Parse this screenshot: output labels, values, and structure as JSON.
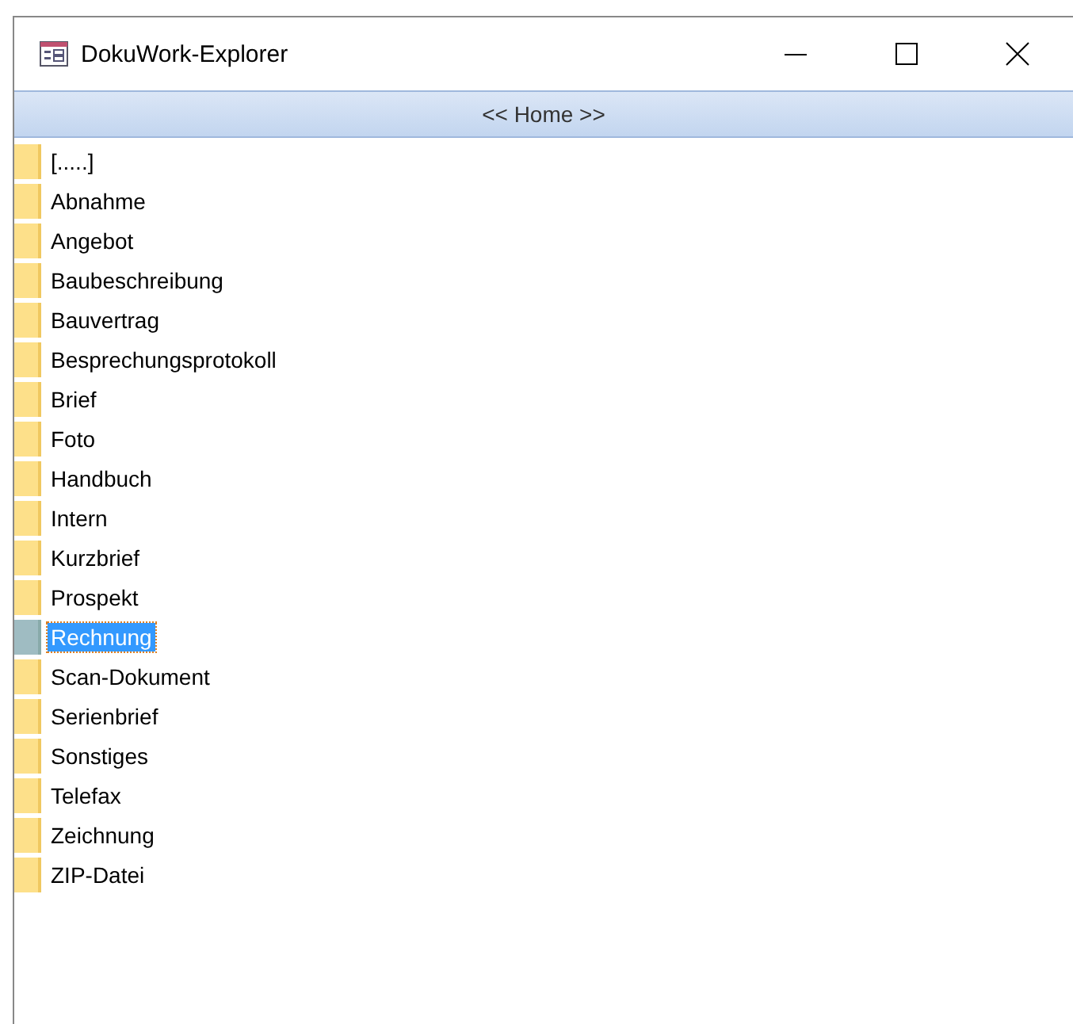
{
  "window": {
    "title": "DokuWork-Explorer"
  },
  "nav": {
    "label": "<< Home >>"
  },
  "items": [
    {
      "label": "[.....]",
      "selected": false
    },
    {
      "label": "Abnahme",
      "selected": false
    },
    {
      "label": "Angebot",
      "selected": false
    },
    {
      "label": "Baubeschreibung",
      "selected": false
    },
    {
      "label": "Bauvertrag",
      "selected": false
    },
    {
      "label": "Besprechungsprotokoll",
      "selected": false
    },
    {
      "label": "Brief",
      "selected": false
    },
    {
      "label": "Foto",
      "selected": false
    },
    {
      "label": "Handbuch",
      "selected": false
    },
    {
      "label": "Intern",
      "selected": false
    },
    {
      "label": "Kurzbrief",
      "selected": false
    },
    {
      "label": "Prospekt",
      "selected": false
    },
    {
      "label": "Rechnung",
      "selected": true
    },
    {
      "label": "Scan-Dokument",
      "selected": false
    },
    {
      "label": "Serienbrief",
      "selected": false
    },
    {
      "label": "Sonstiges",
      "selected": false
    },
    {
      "label": "Telefax",
      "selected": false
    },
    {
      "label": "Zeichnung",
      "selected": false
    },
    {
      "label": "ZIP-Datei",
      "selected": false
    }
  ]
}
